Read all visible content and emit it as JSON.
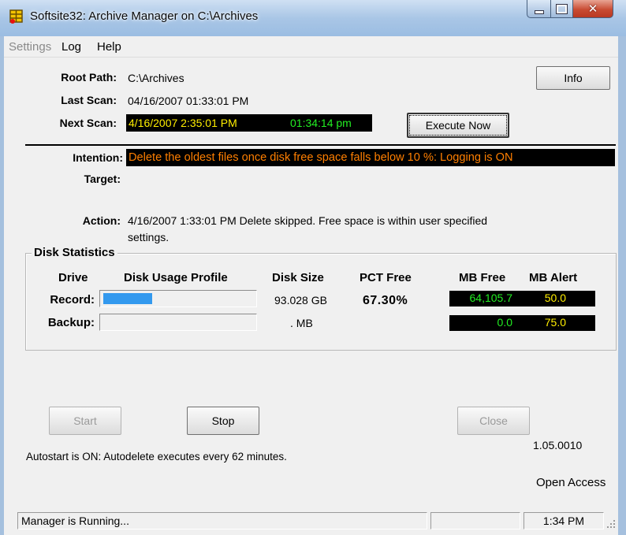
{
  "window": {
    "title": "Softsite32: Archive Manager on C:\\Archives"
  },
  "menu": [
    "Settings",
    "Log",
    "Help"
  ],
  "info": {
    "root_path_label": "Root Path:",
    "root_path": "C:\\Archives",
    "last_scan_label": "Last Scan:",
    "last_scan": "04/16/2007 01:33:01 PM",
    "next_scan_label": "Next Scan:",
    "next_scan": "4/16/2007 2:35:01 PM",
    "countdown": "01:34:14 pm",
    "info_button": "Info",
    "execute_button": "Execute Now"
  },
  "intention": {
    "label": "Intention:",
    "text": "Delete the oldest files once disk free space falls below 10 %:  Logging is ON",
    "color": "#ff7f00"
  },
  "target": {
    "label": "Target:",
    "value": ""
  },
  "action": {
    "label": "Action:",
    "line1": "4/16/2007 1:33:01 PM Delete skipped. Free space is within user specified",
    "line2": "settings."
  },
  "disk_stats": {
    "title": "Disk Statistics",
    "headers": [
      "Drive",
      "Disk Usage Profile",
      "Disk Size",
      "PCT Free",
      "MB Free",
      "MB Alert"
    ],
    "rows": [
      {
        "drive": "Record:",
        "usage_fraction": 0.327,
        "disk_size": "93.028 GB",
        "pct_free": "67.30%",
        "mb_free": "64,105.7",
        "mb_alert": "50.0"
      },
      {
        "drive": "Backup:",
        "usage_fraction": 0,
        "disk_size": ". MB",
        "pct_free": "",
        "mb_free": "0.0",
        "mb_alert": "75.0"
      }
    ],
    "bar_color": "#3399ee",
    "mb_free_color": "#22ee22",
    "mb_alert_color": "#ffee00"
  },
  "buttons": {
    "start": "Start",
    "stop": "Stop",
    "close": "Close"
  },
  "version": "1.05.0010",
  "autostart": "Autostart is ON: Autodelete executes every 62 minutes.",
  "access": "Open Access",
  "status": {
    "message": "Manager is Running...",
    "time": "1:34 PM"
  }
}
